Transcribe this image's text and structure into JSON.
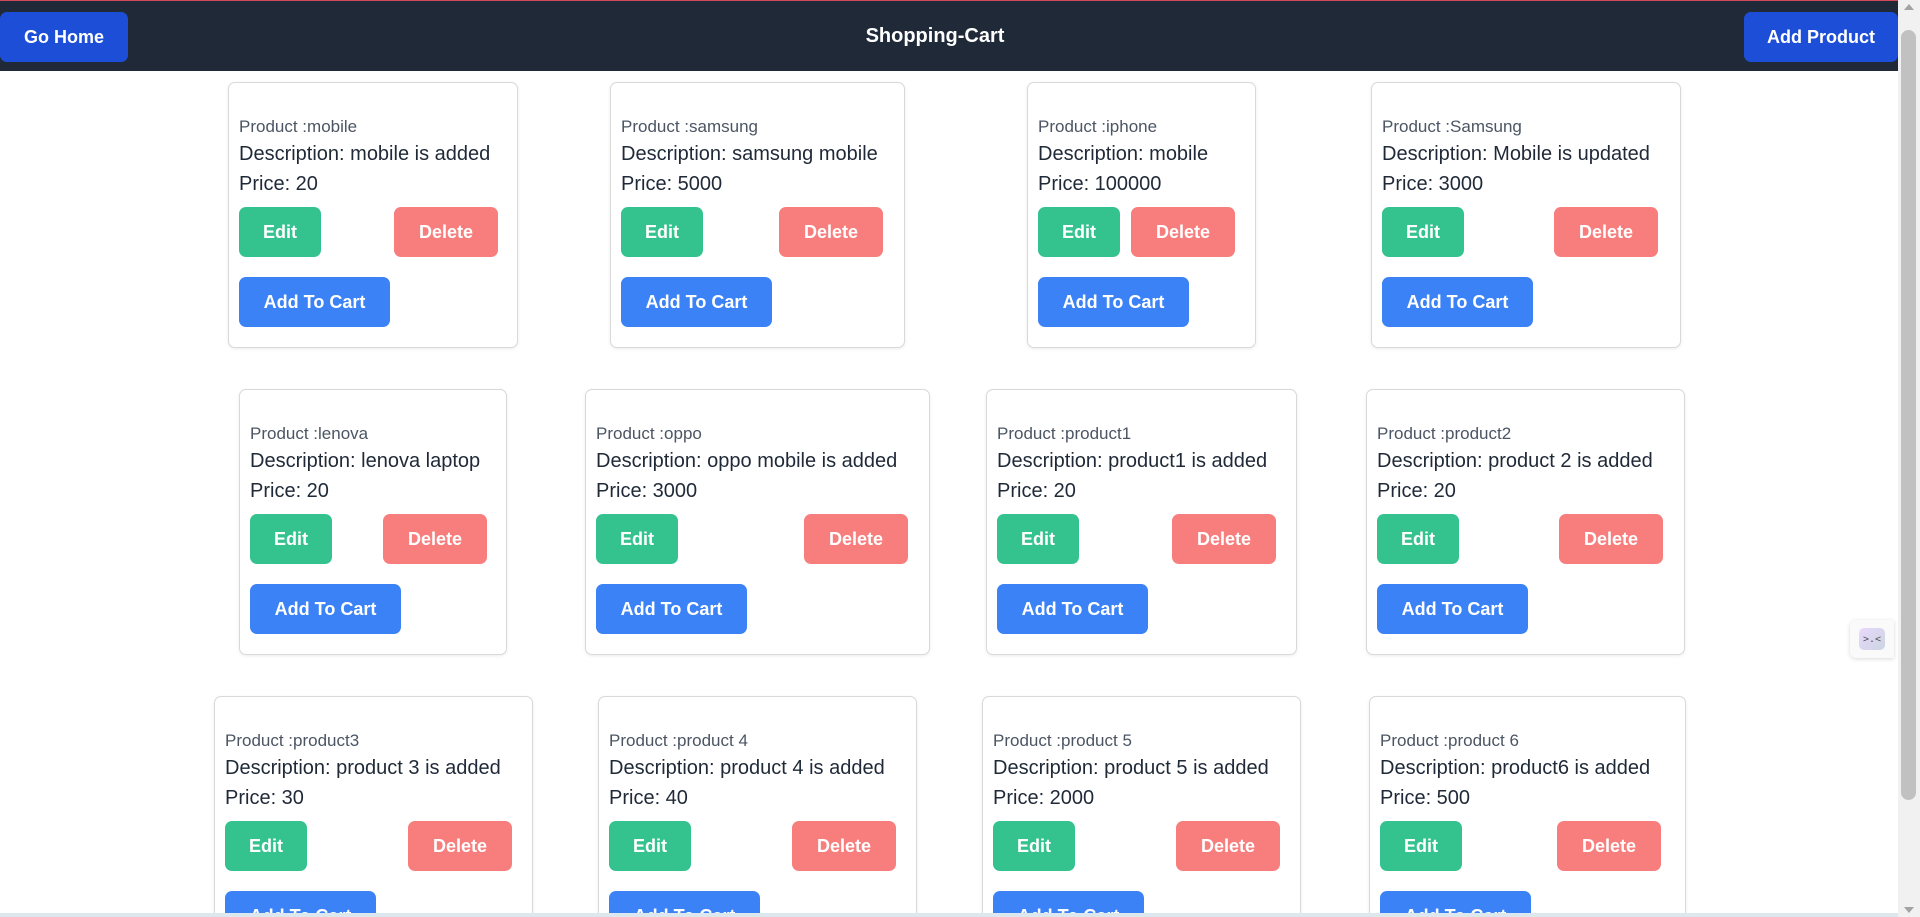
{
  "header": {
    "go_home_label": "Go Home",
    "title": "Shopping-Cart",
    "add_product_label": "Add Product"
  },
  "buttons": {
    "edit": "Edit",
    "delete": "Delete",
    "add_to_cart": "Add To Cart"
  },
  "products": [
    {
      "name": "Product :mobile",
      "description": "Description: mobile is added",
      "price": "Price: 20"
    },
    {
      "name": "Product :samsung",
      "description": "Description: samsung mobile",
      "price": "Price: 5000"
    },
    {
      "name": "Product :iphone",
      "description": "Description: mobile",
      "price": "Price: 100000"
    },
    {
      "name": "Product :Samsung",
      "description": "Description: Mobile is updated",
      "price": "Price: 3000"
    },
    {
      "name": "Product :lenova",
      "description": "Description: lenova laptop",
      "price": "Price: 20"
    },
    {
      "name": "Product :oppo",
      "description": "Description: oppo mobile is added",
      "price": "Price: 3000"
    },
    {
      "name": "Product :product1",
      "description": "Description: product1 is added",
      "price": "Price: 20"
    },
    {
      "name": "Product :product2",
      "description": "Description: product 2 is added",
      "price": "Price: 20"
    },
    {
      "name": "Product :product3",
      "description": "Description: product 3 is added",
      "price": "Price: 30"
    },
    {
      "name": "Product :product 4",
      "description": "Description: product 4 is added",
      "price": "Price: 40"
    },
    {
      "name": "Product :product 5",
      "description": "Description: product 5 is added",
      "price": "Price: 2000"
    },
    {
      "name": "Product :product 6",
      "description": "Description: product6 is added",
      "price": "Price: 500"
    }
  ],
  "widget": {
    "face": ">.<"
  }
}
